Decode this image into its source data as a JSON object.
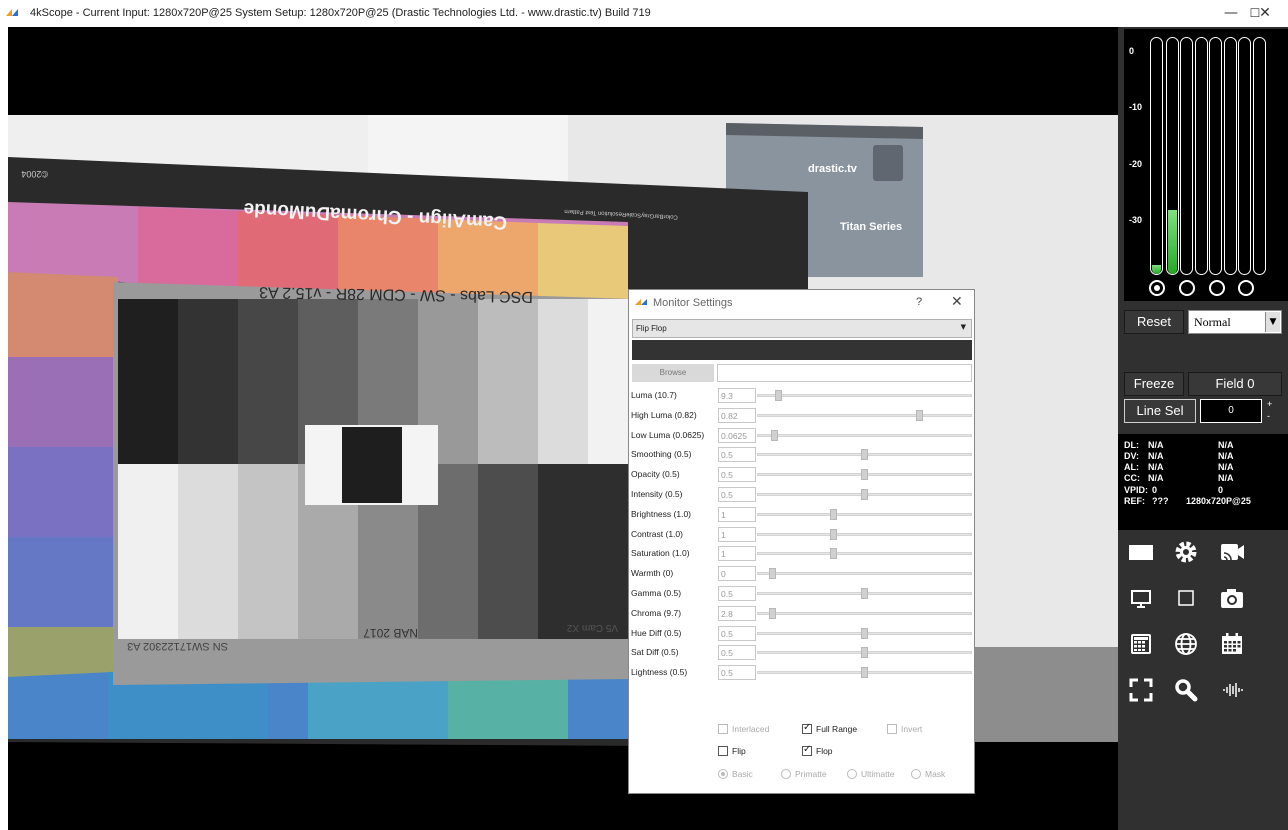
{
  "window": {
    "title": "4kScope -  Current Input: 1280x720P@25  System Setup: 1280x720P@25   (Drastic Technologies Ltd. - www.drastic.tv) Build 719",
    "minimize": "—",
    "maximize": "☐",
    "close": "✕"
  },
  "video": {
    "chart_title": "CamAlign - ChromaDuMonde",
    "chart_subtitle": "DSC Labs - SW - CDM 28R - v15.2 A3",
    "chart_footer_left": "SN SW17122302 A3",
    "chart_footer_mid": "NAB 2017",
    "chart_footer_right": "V5 Cam X2",
    "chart_corner": "©2004",
    "chart_small_text": "ColorBarGrayScaleResolution Test Pattern",
    "banner_brand": "drastic.tv",
    "banner_product": "Titan Series"
  },
  "meters": {
    "db_labels": [
      "0",
      "-10",
      "-20",
      "-30"
    ],
    "levels": [
      0.04,
      0.27,
      0.0,
      0.0,
      0.0,
      0.0,
      0.0,
      0.0
    ],
    "channel_selected": 0
  },
  "controls": {
    "reset": "Reset",
    "mode": "Normal",
    "mode_arrow": "▼",
    "freeze": "Freeze",
    "field": "Field 0",
    "line_sel": "Line Sel",
    "line_value": "0",
    "plus": "+",
    "minus": "-"
  },
  "info": {
    "rows": [
      {
        "label": "DL:",
        "a": "N/A",
        "b": "N/A"
      },
      {
        "label": "DV:",
        "a": "N/A",
        "b": "N/A"
      },
      {
        "label": "AL:",
        "a": "N/A",
        "b": "N/A"
      },
      {
        "label": "CC:",
        "a": "N/A",
        "b": "N/A"
      },
      {
        "label": "VPID:",
        "a": "0",
        "b": "0"
      },
      {
        "label": "REF:",
        "a": "???",
        "b": "1280x720P@25"
      }
    ]
  },
  "icons": [
    "display-white-icon",
    "settings-gear-icon",
    "cast-camera-icon",
    "monitor-icon",
    "square-outline-icon",
    "camera-icon",
    "calculator-grid-icon",
    "globe-icon",
    "calendar-icon",
    "fullscreen-icon",
    "magnifier-icon",
    "audio-waveform-icon"
  ],
  "dialog": {
    "title": "Monitor Settings",
    "help": "?",
    "close": "✕",
    "preset": "Flip Flop",
    "preset_arrow": "▼",
    "browse": "Browse",
    "sliders": [
      {
        "label": "Luma (10.7)",
        "value": "9.3",
        "fraction": 0.03
      },
      {
        "label": "High Luma (0.82)",
        "value": "0.82",
        "fraction": 0.8
      },
      {
        "label": "Low Luma (0.0625)",
        "value": "0.0625",
        "fraction": 0.01
      },
      {
        "label": "Smoothing (0.5)",
        "value": "0.5",
        "fraction": 0.5
      },
      {
        "label": "Opacity (0.5)",
        "value": "0.5",
        "fraction": 0.5
      },
      {
        "label": "Intensity (0.5)",
        "value": "0.5",
        "fraction": 0.5
      },
      {
        "label": "Brightness (1.0)",
        "value": "1",
        "fraction": 0.33
      },
      {
        "label": "Contrast (1.0)",
        "value": "1",
        "fraction": 0.33
      },
      {
        "label": "Saturation (1.0)",
        "value": "1",
        "fraction": 0.33
      },
      {
        "label": "Warmth (0)",
        "value": "0",
        "fraction": 0.0
      },
      {
        "label": "Gamma (0.5)",
        "value": "0.5",
        "fraction": 0.5
      },
      {
        "label": "Chroma (9.7)",
        "value": "2.8",
        "fraction": 0.0
      },
      {
        "label": "Hue Diff (0.5)",
        "value": "0.5",
        "fraction": 0.5
      },
      {
        "label": "Sat Diff (0.5)",
        "value": "0.5",
        "fraction": 0.5
      },
      {
        "label": "Lightness (0.5)",
        "value": "0.5",
        "fraction": 0.5
      }
    ],
    "interlaced": "Interlaced",
    "full_range": "Full Range",
    "invert": "Invert",
    "flip": "Flip",
    "flop": "Flop",
    "basic": "Basic",
    "primatte": "Primatte",
    "ultimatte": "Ultimatte",
    "mask": "Mask"
  }
}
